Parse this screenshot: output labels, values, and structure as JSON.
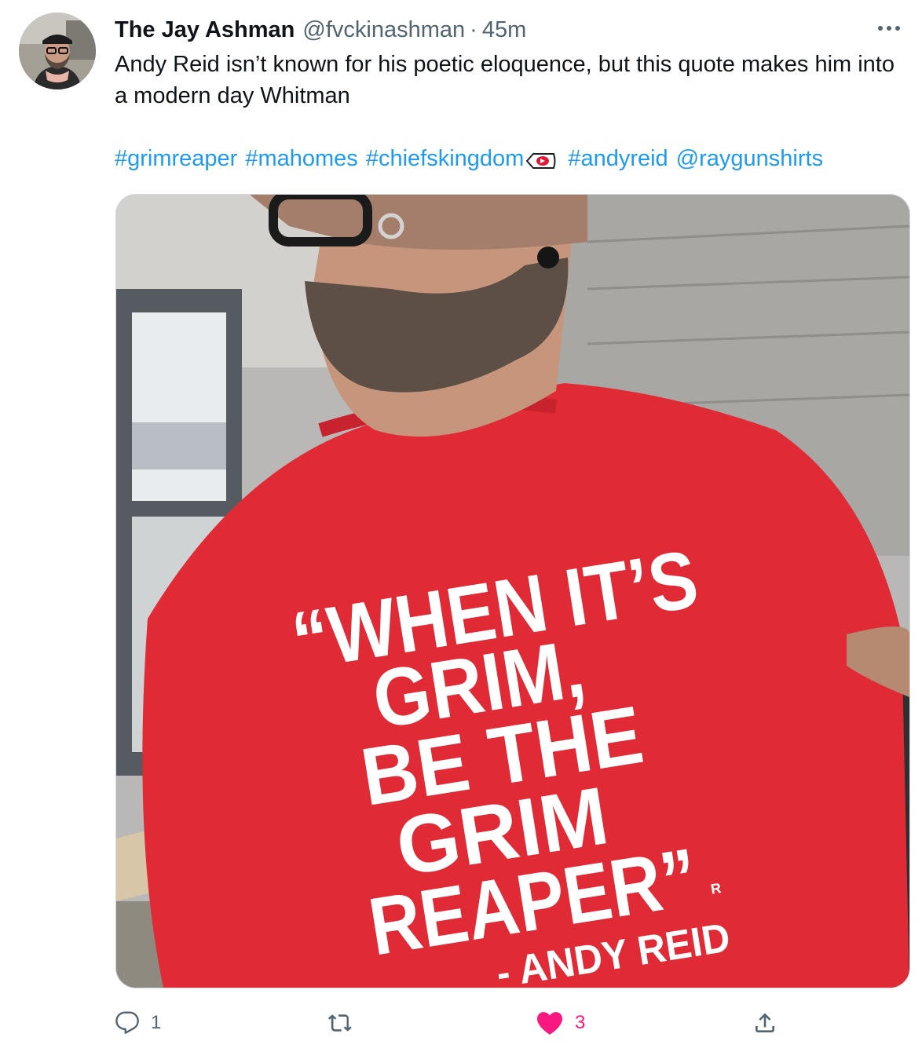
{
  "tweet": {
    "author_name": "The Jay Ashman",
    "handle": "@fvckinashman",
    "separator": "·",
    "time": "45m",
    "more_icon": "more-horizontal-icon",
    "text": "Andy Reid isn’t known for his poetic eloquence, but this quote makes him into a modern day Whitman",
    "hashtags": [
      "#grimreaper",
      "#mahomes",
      "#chiefskingdom",
      "#andyreid"
    ],
    "mention": "@raygunshirts",
    "emoji": "chiefs-arrowhead-emoji",
    "link_color": "#1d9bf0"
  },
  "photo": {
    "shirt_color": "#e02b36",
    "shirt_lines": [
      "“WHEN IT’S",
      "GRIM,",
      "BE THE",
      "GRIM",
      "REAPER”"
    ],
    "registered_mark": "R",
    "attribution": "- ANDY REID"
  },
  "actions": {
    "reply": {
      "icon": "reply-icon",
      "count": "1"
    },
    "retweet": {
      "icon": "retweet-icon",
      "count": ""
    },
    "like": {
      "icon": "heart-icon",
      "count": "3",
      "color": "#f91880"
    },
    "share": {
      "icon": "share-icon"
    }
  }
}
